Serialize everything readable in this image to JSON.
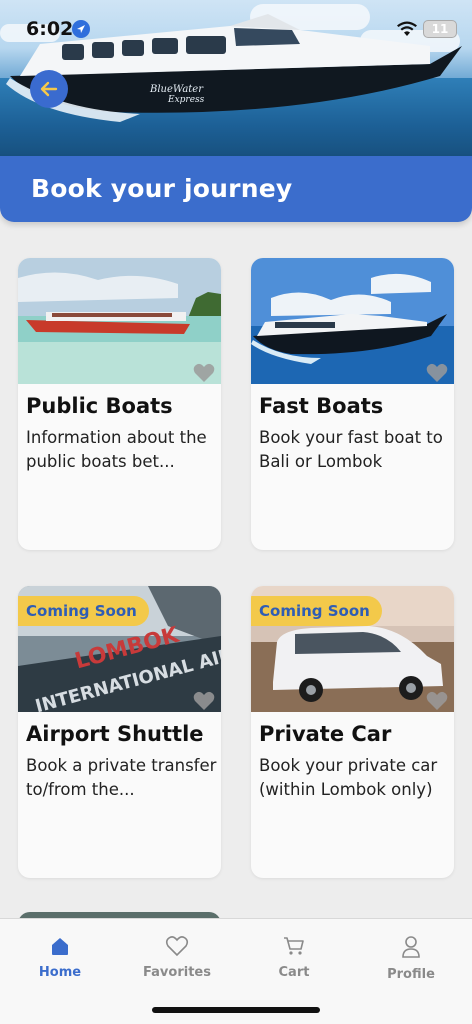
{
  "status_bar": {
    "time": "6:02",
    "battery": "11"
  },
  "hero": {
    "boat_brand_line1": "BlueWater",
    "boat_brand_line2": "Express"
  },
  "header": {
    "title": "Book your journey"
  },
  "cards": [
    {
      "title": "Public Boats",
      "description": "Information about the public boats bet...",
      "badge": ""
    },
    {
      "title": "Fast Boats",
      "description": "Book your fast boat to Bali or Lombok",
      "badge": ""
    },
    {
      "title": "Airport Shuttle",
      "description": "Book a private transfer to/from the...",
      "badge": "Coming Soon",
      "sign_line1": "LOMBOK",
      "sign_line2": "INTERNATIONAL AIRPORT"
    },
    {
      "title": "Private Car",
      "description": "Book your private car (within Lombok only)",
      "badge": "Coming Soon"
    }
  ],
  "bottom_nav": {
    "items": [
      {
        "label": "Home",
        "icon": "home-icon",
        "active": true
      },
      {
        "label": "Favorites",
        "icon": "heart-icon",
        "active": false
      },
      {
        "label": "Cart",
        "icon": "cart-icon",
        "active": false
      },
      {
        "label": "Profile",
        "icon": "profile-icon",
        "active": false
      }
    ]
  },
  "colors": {
    "primary": "#3b6dcc",
    "badge": "#f3c94a",
    "background": "#ededed"
  }
}
